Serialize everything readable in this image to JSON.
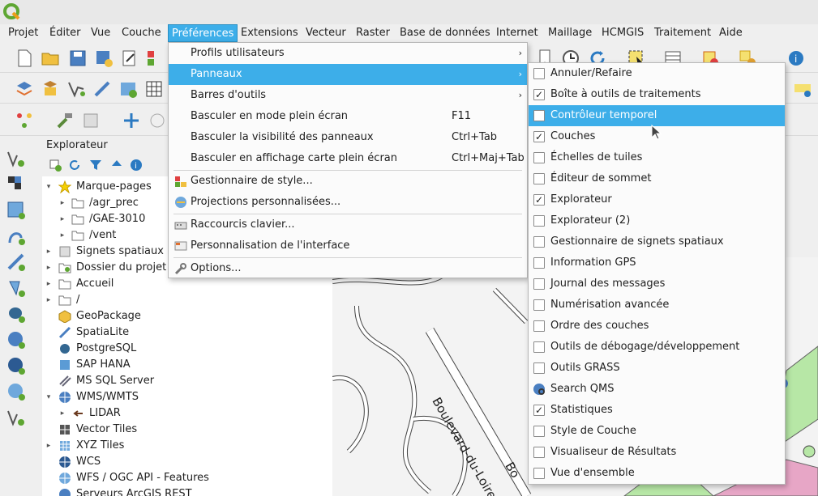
{
  "menubar": {
    "items": [
      "Projet",
      "Éditer",
      "Vue",
      "Couche",
      "Préférences",
      "Extensions",
      "Vecteur",
      "Raster",
      "Base de données",
      "Internet",
      "Maillage",
      "HCMGIS",
      "Traitement",
      "Aide"
    ]
  },
  "explorer": {
    "title": "Explorateur",
    "items": [
      {
        "label": "Marque-pages",
        "icon": "star-icon"
      },
      {
        "label": "/agr_prec",
        "icon": "folder-icon"
      },
      {
        "label": "/GAE-3010",
        "icon": "folder-icon"
      },
      {
        "label": "/vent",
        "icon": "folder-icon"
      },
      {
        "label": "Signets spatiaux",
        "icon": "bookmark-icon"
      },
      {
        "label": "Dossier du projet",
        "icon": "project-folder-icon"
      },
      {
        "label": "Accueil",
        "icon": "folder-icon"
      },
      {
        "label": "/",
        "icon": "folder-icon"
      },
      {
        "label": "GeoPackage",
        "icon": "geopackage-icon"
      },
      {
        "label": "SpatiaLite",
        "icon": "spatialite-icon"
      },
      {
        "label": "PostgreSQL",
        "icon": "postgresql-icon"
      },
      {
        "label": "SAP HANA",
        "icon": "sap-hana-icon"
      },
      {
        "label": "MS SQL Server",
        "icon": "mssql-icon"
      },
      {
        "label": "WMS/WMTS",
        "icon": "globe-icon"
      },
      {
        "label": "LIDAR",
        "icon": "lidar-icon"
      },
      {
        "label": "Vector Tiles",
        "icon": "vector-tiles-icon"
      },
      {
        "label": "XYZ Tiles",
        "icon": "xyz-tiles-icon"
      },
      {
        "label": "WCS",
        "icon": "globe-icon"
      },
      {
        "label": "WFS / OGC API - Features",
        "icon": "globe-icon"
      },
      {
        "label": "Serveurs ArcGIS REST",
        "icon": "globe-icon"
      }
    ]
  },
  "prefs_menu": {
    "items": [
      {
        "label": "Profils utilisateurs",
        "shortcut": "",
        "submenu": true
      },
      {
        "label": "Panneaux",
        "shortcut": "",
        "submenu": true
      },
      {
        "label": "Barres d'outils",
        "shortcut": "",
        "submenu": true
      },
      {
        "label": "Basculer en mode plein écran",
        "shortcut": "F11"
      },
      {
        "label": "Basculer la visibilité des panneaux",
        "shortcut": "Ctrl+Tab"
      },
      {
        "label": "Basculer en affichage carte plein écran",
        "shortcut": "Ctrl+Maj+Tab"
      },
      {
        "label": "Gestionnaire de style...",
        "shortcut": ""
      },
      {
        "label": "Projections personnalisées...",
        "shortcut": ""
      },
      {
        "label": "Raccourcis clavier...",
        "shortcut": ""
      },
      {
        "label": "Personnalisation de l'interface",
        "shortcut": ""
      },
      {
        "label": "Options...",
        "shortcut": ""
      }
    ]
  },
  "panels_menu": {
    "items": [
      {
        "label": "Annuler/Refaire",
        "checked": false
      },
      {
        "label": "Boîte à outils de traitements",
        "checked": true
      },
      {
        "label": "Contrôleur temporel",
        "checked": false
      },
      {
        "label": "Couches",
        "checked": true
      },
      {
        "label": "Échelles de tuiles",
        "checked": false
      },
      {
        "label": "Éditeur de sommet",
        "checked": false
      },
      {
        "label": "Explorateur",
        "checked": true
      },
      {
        "label": "Explorateur (2)",
        "checked": false
      },
      {
        "label": "Gestionnaire de signets spatiaux",
        "checked": false
      },
      {
        "label": "Information GPS",
        "checked": false
      },
      {
        "label": "Journal des messages",
        "checked": false
      },
      {
        "label": "Numérisation avancée",
        "checked": false
      },
      {
        "label": "Ordre des couches",
        "checked": false
      },
      {
        "label": "Outils de débogage/développement",
        "checked": false
      },
      {
        "label": "Outils GRASS",
        "checked": false
      },
      {
        "label": "Search QMS",
        "checked": null
      },
      {
        "label": "Statistiques",
        "checked": true
      },
      {
        "label": "Style de Couche",
        "checked": false
      },
      {
        "label": "Visualiseur de Résultats",
        "checked": false
      },
      {
        "label": "Vue d'ensemble",
        "checked": false
      }
    ]
  },
  "map": {
    "street_label_1": "Boulevard-du-Loire",
    "street_label_2": "Bo"
  },
  "glyphs": {
    "check": "✓",
    "arrow_right": "▸",
    "arrow_down": "▾",
    "arrow_collapsed": "›"
  },
  "colors": {
    "highlight": "#3daee9",
    "qgis_green": "#5ea632",
    "map_green": "#b7e7a6",
    "map_pink": "#e7a6c6"
  }
}
